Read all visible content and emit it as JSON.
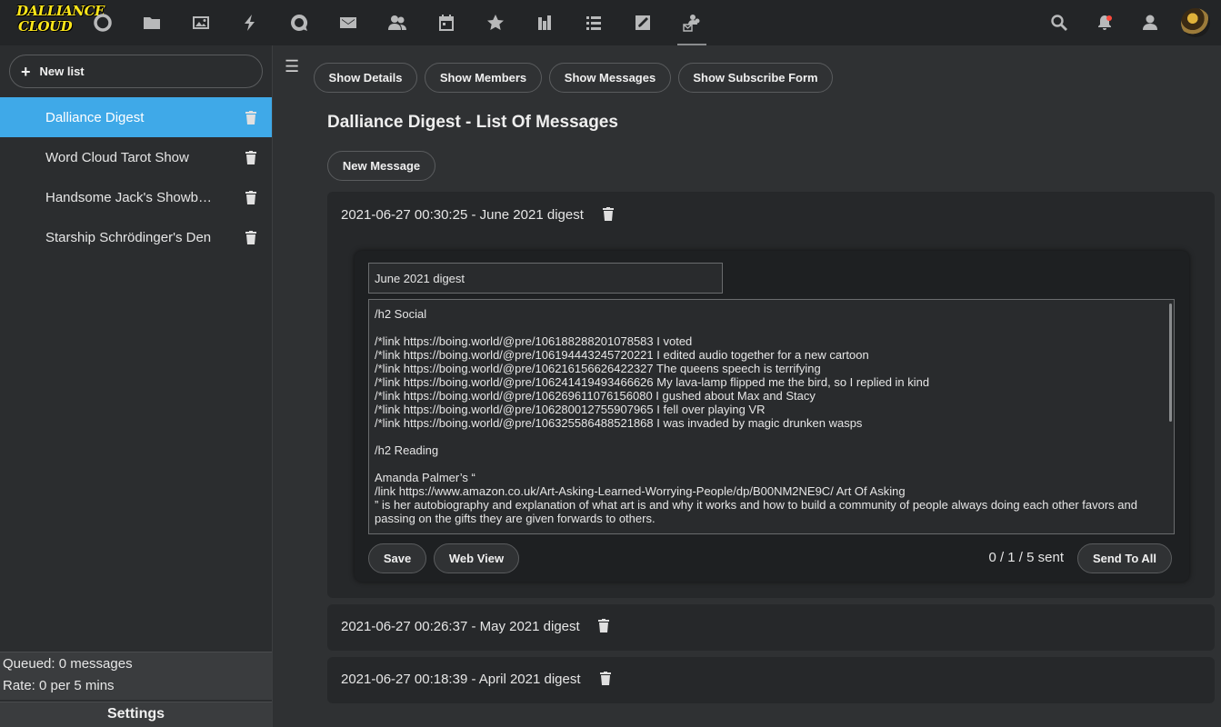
{
  "app": {
    "logo_line1": "DALLIANCE",
    "logo_line2": "CLOUD"
  },
  "topnav": {
    "icons": [
      "circle-icon",
      "folder-icon",
      "image-icon",
      "lightning-icon",
      "chat-icon",
      "mail-icon",
      "contacts-icon",
      "calendar-icon",
      "star-icon",
      "chart-icon",
      "list-icon",
      "edit-icon",
      "newsletter-icon"
    ],
    "right_icons": [
      "search-icon",
      "bell-icon",
      "user-icon",
      "avatar"
    ],
    "active": "newsletter-icon"
  },
  "sidebar": {
    "new_list_label": "New list",
    "items": [
      {
        "label": "Dalliance Digest",
        "selected": true
      },
      {
        "label": "Word Cloud Tarot Show",
        "selected": false
      },
      {
        "label": "Handsome Jack's Showboat",
        "selected": false
      },
      {
        "label": "Starship Schrödinger's Den",
        "selected": false
      }
    ],
    "queued": "Queued: 0 messages",
    "rate": "Rate: 0 per 5 mins",
    "settings_label": "Settings"
  },
  "toolbar": {
    "show_details": "Show Details",
    "show_members": "Show Members",
    "show_messages": "Show Messages",
    "show_subscribe_form": "Show Subscribe Form"
  },
  "main": {
    "title": "Dalliance Digest - List Of Messages",
    "new_message_label": "New Message",
    "messages": [
      {
        "header": "2021-06-27 00:30:25 - June 2021 digest",
        "expanded": true
      },
      {
        "header": "2021-06-27 00:26:37 - May 2021 digest",
        "expanded": false
      },
      {
        "header": "2021-06-27 00:18:39 - April 2021 digest",
        "expanded": false
      }
    ]
  },
  "editor": {
    "subject_value": "June 2021 digest",
    "body_lines": [
      "/h2 Social",
      "",
      "/*link https://boing.world/@pre/106188288201078583 I voted",
      "/*link https://boing.world/@pre/106194443245720221 I edited audio together for a new cartoon",
      "/*link https://boing.world/@pre/106216156626422327 The queens speech is terrifying",
      "/*link https://boing.world/@pre/106241419493466626 My lava-lamp flipped me the bird, so I replied in kind",
      "/*link https://boing.world/@pre/106269611076156080 I gushed about Max and Stacy",
      "/*link https://boing.world/@pre/106280012755907965 I fell over playing VR",
      "/*link https://boing.world/@pre/106325586488521868 I was invaded by magic drunken wasps",
      "",
      "/h2 Reading",
      "",
      "Amanda Palmer’s “",
      "/link https://www.amazon.co.uk/Art-Asking-Learned-Worrying-People/dp/B00NM2NE9C/ Art Of Asking",
      "” is her autobiography and explanation of what art is and why it works and how to build a community of people always doing each other favors and passing on the gifts they are given forwards to others."
    ],
    "save_label": "Save",
    "web_view_label": "Web View",
    "sent_status": "0 / 1 / 5 sent",
    "send_all_label": "Send To All"
  }
}
